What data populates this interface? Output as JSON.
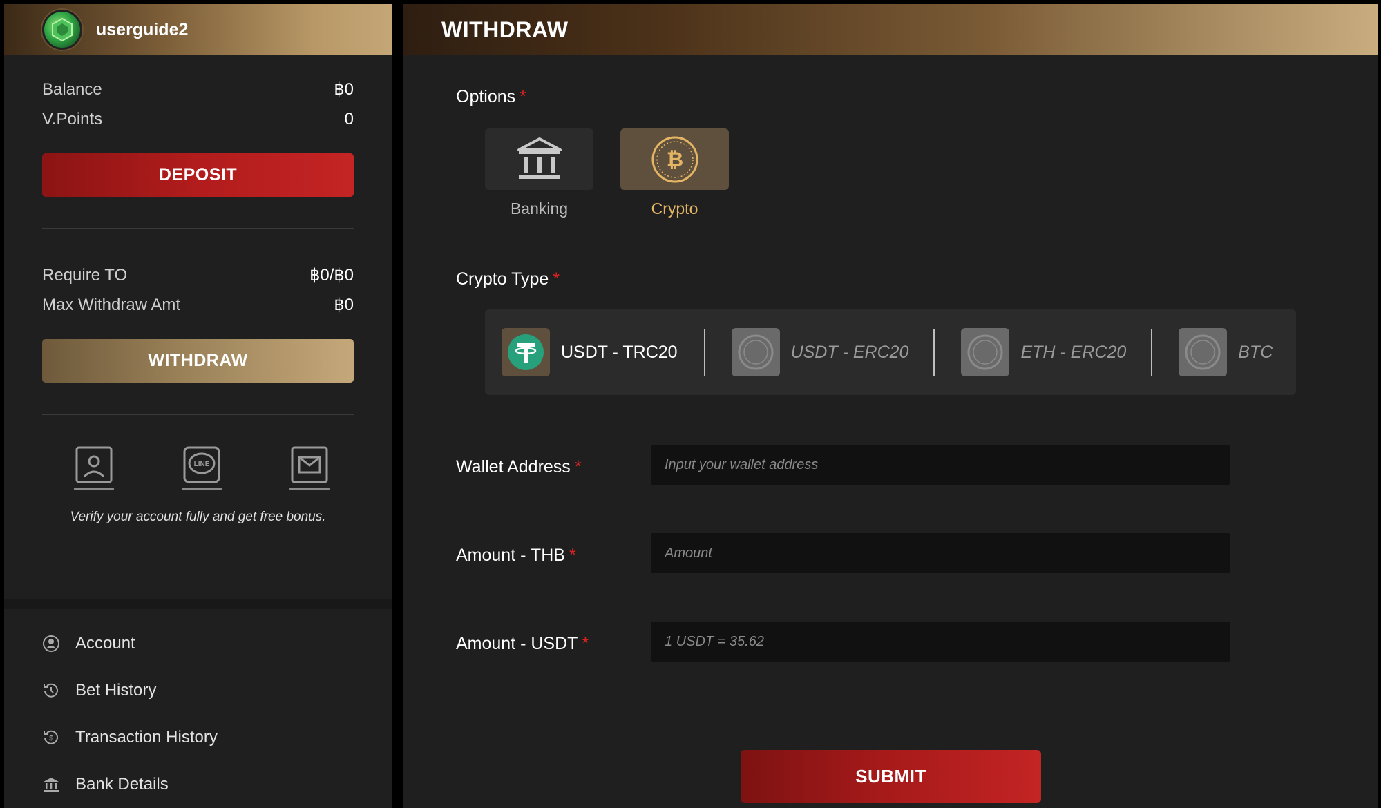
{
  "user": {
    "name": "userguide2"
  },
  "balances": [
    {
      "label": "Balance",
      "value": "฿0"
    },
    {
      "label": "V.Points",
      "value": "0"
    }
  ],
  "buttons": {
    "deposit": "DEPOSIT",
    "withdraw": "WITHDRAW",
    "submit": "SUBMIT"
  },
  "turnover": [
    {
      "label": "Require TO",
      "value": "฿0/฿0"
    },
    {
      "label": "Max Withdraw Amt",
      "value": "฿0"
    }
  ],
  "verify": {
    "icons": [
      "id-card-icon",
      "line-chat-icon",
      "mail-icon"
    ],
    "text": "Verify your account fully and get free bonus."
  },
  "menu": [
    {
      "label": "Account",
      "icon": "user-circle-icon"
    },
    {
      "label": "Bet History",
      "icon": "history-icon"
    },
    {
      "label": "Transaction History",
      "icon": "transaction-icon"
    },
    {
      "label": "Bank Details",
      "icon": "bank-icon"
    }
  ],
  "page": {
    "title": "WITHDRAW"
  },
  "options": {
    "label": "Options",
    "required_mark": "*",
    "items": [
      {
        "label": "Banking",
        "icon": "bank-icon",
        "selected": false
      },
      {
        "label": "Crypto",
        "icon": "bitcoin-icon",
        "selected": true
      }
    ]
  },
  "crypto_type": {
    "label": "Crypto Type",
    "required_mark": "*",
    "items": [
      {
        "label": "USDT - TRC20",
        "icon": "tether-icon",
        "selected": true
      },
      {
        "label": "USDT - ERC20",
        "icon": "coin-placeholder-icon",
        "selected": false
      },
      {
        "label": "ETH - ERC20",
        "icon": "coin-placeholder-icon",
        "selected": false
      },
      {
        "label": "BTC",
        "icon": "coin-placeholder-icon",
        "selected": false
      }
    ]
  },
  "fields": {
    "wallet": {
      "label": "Wallet Address",
      "required_mark": "*",
      "placeholder": "Input your wallet address"
    },
    "amount_thb": {
      "label": "Amount - THB",
      "required_mark": "*",
      "placeholder": "Amount"
    },
    "amount_usdt": {
      "label": "Amount - USDT",
      "required_mark": "*",
      "placeholder": "1 USDT = 35.62"
    }
  },
  "colors": {
    "accent_gold": "#c5a87a",
    "accent_red": "#b21c1c",
    "crypto_selected": "#e3b564",
    "tether_green": "#26a17b"
  }
}
